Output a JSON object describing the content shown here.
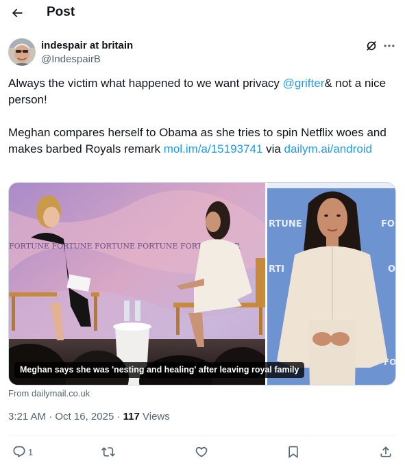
{
  "header": {
    "title": "Post",
    "back_icon": "arrow-left-icon"
  },
  "author": {
    "display_name": "indespair at britain",
    "handle": "@IndespairB",
    "avatar_icon": "avatar-photo"
  },
  "tweet": {
    "line1_text": "Always the victim what happened to we want privacy ",
    "line1_mention": "@grifter",
    "line1_rest": "& not a nice person!",
    "line2_text": "Meghan compares herself to Obama as she tries to spin Netflix woes and makes barbed Royals remark ",
    "line2_link": "mol.im/a/15193741",
    "line2_via": " via ",
    "line2_link2": "dailym.ai/android"
  },
  "media": {
    "caption": "Meghan says she was 'nesting and healing' after leaving royal family",
    "banner_text_left": "FORTUNE FORTUNE FORTUNE FORTUNE FORTUNE FOR",
    "banner_text_right": "RTUNE"
  },
  "card": {
    "source": "From dailymail.co.uk"
  },
  "meta": {
    "time": "3:21 AM",
    "separator": " · ",
    "date": "Oct 16, 2025",
    "separator2": " · ",
    "views_count": "117",
    "views_label": " Views"
  },
  "actions": {
    "reply_count": "1",
    "retweet_count": "",
    "like_count": "",
    "bookmark_count": "",
    "share_count": ""
  },
  "colors": {
    "link": "#1d9bf0",
    "secondary_text": "#536471",
    "primary_text": "#0f1419",
    "divider": "#eff3f4"
  }
}
